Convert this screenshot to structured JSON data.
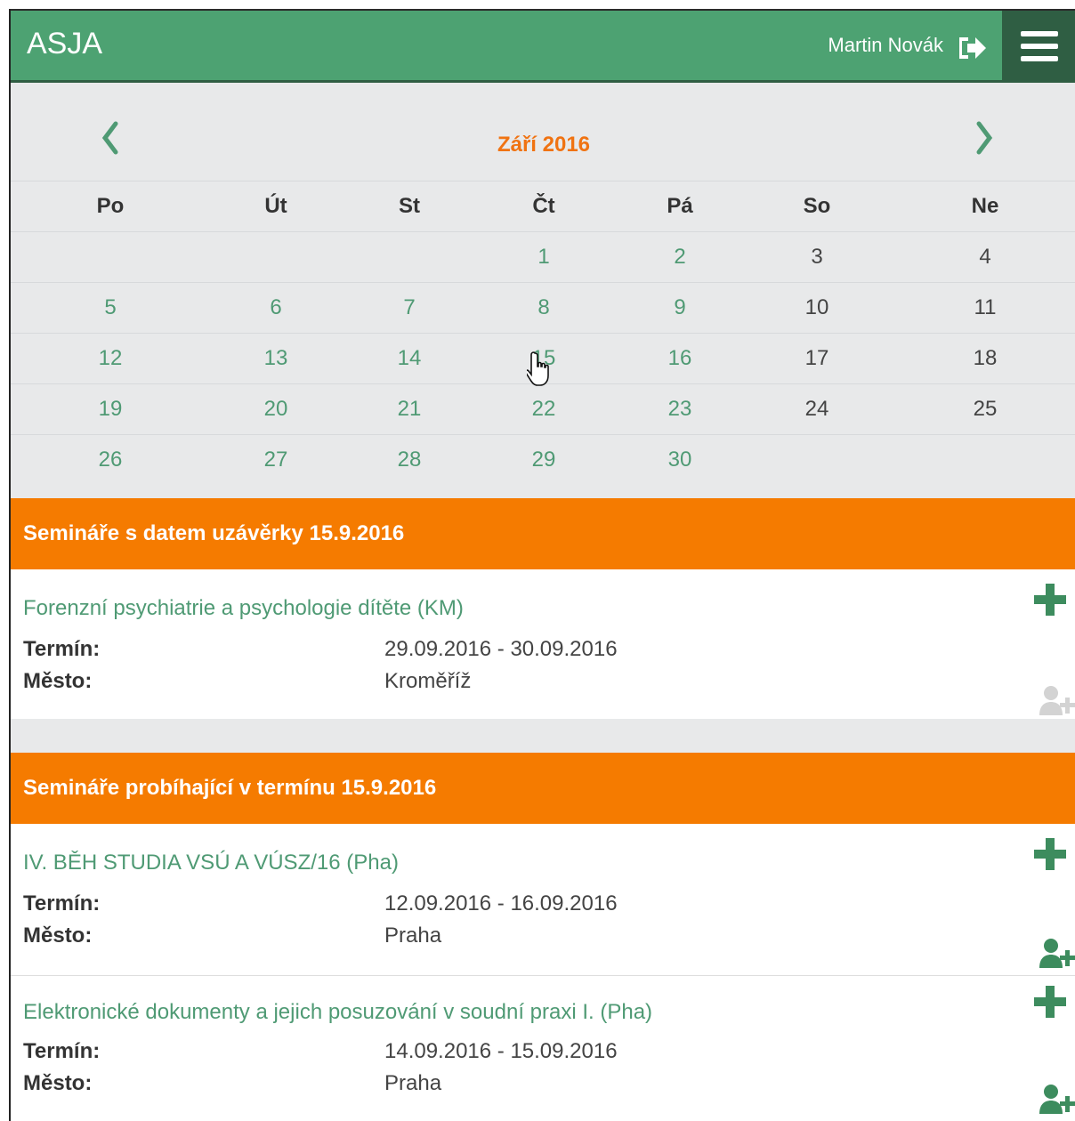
{
  "header": {
    "brand": "ASJA",
    "user": "Martin Novák",
    "logout_icon": "sign-out-icon",
    "menu_icon": "hamburger-menu-icon",
    "colors": {
      "brand_green": "#4da272",
      "dark_green": "#2f5e43",
      "accent_orange": "#f57b00"
    }
  },
  "calendar": {
    "month_label": "Září 2016",
    "weekdays": [
      "Po",
      "Út",
      "St",
      "Čt",
      "Pá",
      "So",
      "Ne"
    ],
    "weeks": [
      [
        "",
        "",
        "",
        "1",
        "2",
        "3",
        "4"
      ],
      [
        "5",
        "6",
        "7",
        "8",
        "9",
        "10",
        "11"
      ],
      [
        "12",
        "13",
        "14",
        "15",
        "16",
        "17",
        "18"
      ],
      [
        "19",
        "20",
        "21",
        "22",
        "23",
        "24",
        "25"
      ],
      [
        "26",
        "27",
        "28",
        "29",
        "30",
        "",
        ""
      ]
    ]
  },
  "sections": [
    {
      "header": "Semináře s datem uzávěrky 15.9.2016",
      "items": [
        {
          "title": "Forenzní psychiatrie a psychologie dítěte (KM)",
          "term_label": "Termín:",
          "term": "29.09.2016 - 30.09.2016",
          "city_label": "Město:",
          "city": "Kroměříž",
          "register_enabled": false
        }
      ]
    },
    {
      "header": "Semináře probíhající v termínu 15.9.2016",
      "items": [
        {
          "title": "IV. BĚH STUDIA VSÚ A VÚSZ/16 (Pha)",
          "term_label": "Termín:",
          "term": "12.09.2016 - 16.09.2016",
          "city_label": "Město:",
          "city": "Praha",
          "register_enabled": true
        },
        {
          "title": "Elektronické dokumenty a jejich posuzování v soudní praxi I. (Pha)",
          "term_label": "Termín:",
          "term": "14.09.2016 - 15.09.2016",
          "city_label": "Město:",
          "city": "Praha",
          "register_enabled": true
        }
      ]
    }
  ]
}
